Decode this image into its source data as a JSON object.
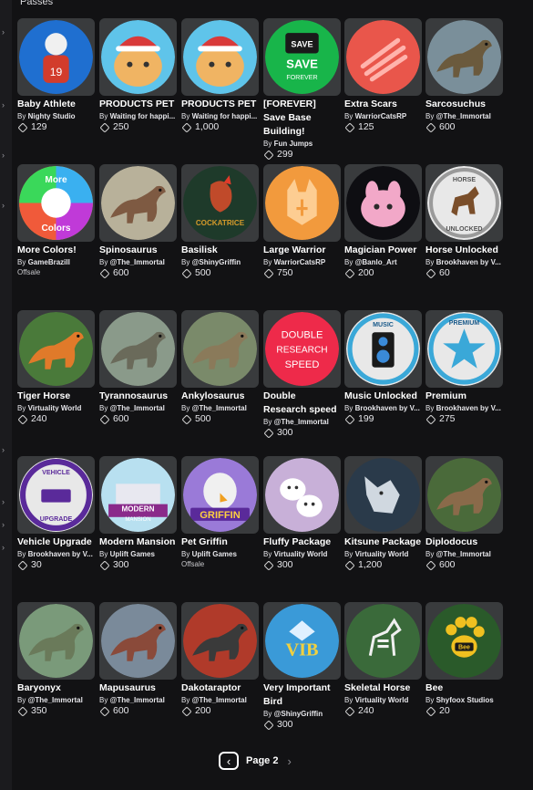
{
  "section_title": "Passes",
  "colors": {
    "background": "#121214",
    "card": "#393b3d",
    "text": "#ffffff"
  },
  "passes": [
    {
      "name": "Baby Athlete",
      "by": "By",
      "creator": "Nighty Studio",
      "price": "129",
      "icon": "football-player-icon",
      "bg": "#1f6fd0",
      "fg": "#d23c2c"
    },
    {
      "name": "PRODUCTS PET",
      "by": "By",
      "creator": "Waiting for happi...",
      "price": "250",
      "icon": "santa-cat-icon",
      "bg": "#5fc4ea",
      "fg": "#f0b463"
    },
    {
      "name": "PRODUCTS PET",
      "by": "By",
      "creator": "Waiting for happi...",
      "price": "1,000",
      "icon": "santa-cat-icon",
      "bg": "#5fc4ea",
      "fg": "#f0b463"
    },
    {
      "name": "[FOREVER] Save Base Building!",
      "by": "By",
      "creator": "Fun Jumps",
      "price": "299",
      "icon": "save-forever-icon",
      "bg": "#18b54a",
      "fg": "#ffffff"
    },
    {
      "name": "Extra Scars",
      "by": "By",
      "creator": "WarriorCatsRP",
      "price": "125",
      "icon": "claw-scars-icon",
      "bg": "#e9564b",
      "fg": "#ffb3ac"
    },
    {
      "name": "Sarcosuchus",
      "by": "By",
      "creator": "@The_Immortal",
      "price": "600",
      "icon": "crocodile-icon",
      "bg": "#7a8f9a",
      "fg": "#6b5a3d"
    },
    {
      "name": "More Colors!",
      "by": "By",
      "creator": "GameBrazill",
      "offsale": "Offsale",
      "icon": "color-wheel-icon",
      "bg": "#f1c232",
      "fg": "#ffffff"
    },
    {
      "name": "Spinosaurus",
      "by": "By",
      "creator": "@The_Immortal",
      "price": "600",
      "icon": "spinosaurus-icon",
      "bg": "#b8b19a",
      "fg": "#7e5a42"
    },
    {
      "name": "Basilisk",
      "by": "By",
      "creator": "@ShinyGriffin",
      "price": "500",
      "icon": "cockatrice-icon",
      "bg": "#1e3a2a",
      "fg": "#d49a2a"
    },
    {
      "name": "Large Warrior",
      "by": "By",
      "creator": "WarriorCatsRP",
      "price": "750",
      "icon": "warrior-cat-icon",
      "bg": "#f29a3d",
      "fg": "#ffd9a8"
    },
    {
      "name": "Magician Power",
      "by": "By",
      "creator": "@Banlo_Art",
      "price": "200",
      "icon": "pink-creature-icon",
      "bg": "#0e0e12",
      "fg": "#f2a8c8"
    },
    {
      "name": "Horse Unlocked",
      "by": "By",
      "creator": "Brookhaven by V...",
      "price": "60",
      "icon": "horse-badge-icon",
      "bg": "#e8e8e8",
      "fg": "#7a4e2a"
    },
    {
      "name": "Tiger Horse",
      "by": "By",
      "creator": "Virtuality World",
      "price": "240",
      "icon": "tiger-horse-icon",
      "bg": "#4a7a3a",
      "fg": "#e07a2a"
    },
    {
      "name": "Tyrannosaurus",
      "by": "By",
      "creator": "@The_Immortal",
      "price": "600",
      "icon": "tyrannosaurus-icon",
      "bg": "#8a9a8a",
      "fg": "#6a6a5a"
    },
    {
      "name": "Ankylosaurus",
      "by": "By",
      "creator": "@The_Immortal",
      "price": "500",
      "icon": "ankylosaurus-icon",
      "bg": "#7a8a6a",
      "fg": "#8a7a5a"
    },
    {
      "name": "Double Research speed",
      "by": "By",
      "creator": "@The_Immortal",
      "price": "300",
      "icon": "double-research-icon",
      "bg": "#ee2a4a",
      "fg": "#ffffff",
      "label": "DOUBLE RESEARCH SPEED"
    },
    {
      "name": "Music Unlocked",
      "by": "By",
      "creator": "Brookhaven by V...",
      "price": "199",
      "icon": "music-speaker-icon",
      "bg": "#e8e8e8",
      "fg": "#1a1a1a"
    },
    {
      "name": "Premium",
      "by": "By",
      "creator": "Brookhaven by V...",
      "price": "275",
      "icon": "premium-star-icon",
      "bg": "#e8e8e8",
      "fg": "#3aa8d8"
    },
    {
      "name": "Vehicle Upgrade",
      "by": "By",
      "creator": "Brookhaven by V...",
      "price": "30",
      "icon": "vehicle-upgrade-icon",
      "bg": "#e8e8e8",
      "fg": "#5a2a9a"
    },
    {
      "name": "Modern Mansion",
      "by": "By",
      "creator": "Uplift Games",
      "price": "300",
      "icon": "mansion-icon",
      "bg": "#b8e0f0",
      "fg": "#8a2a8a"
    },
    {
      "name": "Pet Griffin",
      "by": "By",
      "creator": "Uplift Games",
      "offsale": "Offsale",
      "icon": "griffin-icon",
      "bg": "#9a7ad8",
      "fg": "#f0f0f0"
    },
    {
      "name": "Fluffy Package",
      "by": "By",
      "creator": "Virtuality World",
      "price": "300",
      "icon": "fluffy-cats-icon",
      "bg": "#c8b0d8",
      "fg": "#ffffff"
    },
    {
      "name": "Kitsune Package",
      "by": "By",
      "creator": "Virtuality World",
      "price": "1,200",
      "icon": "kitsune-icon",
      "bg": "#2a3a4a",
      "fg": "#d0d8e0"
    },
    {
      "name": "Diplodocus",
      "by": "By",
      "creator": "@The_Immortal",
      "price": "600",
      "icon": "diplodocus-icon",
      "bg": "#4a6a3a",
      "fg": "#8a6a4a"
    },
    {
      "name": "Baryonyx",
      "by": "By",
      "creator": "@The_Immortal",
      "price": "350",
      "icon": "baryonyx-icon",
      "bg": "#7a9a7a",
      "fg": "#6a7a5a"
    },
    {
      "name": "Mapusaurus",
      "by": "By",
      "creator": "@The_Immortal",
      "price": "600",
      "icon": "mapusaurus-icon",
      "bg": "#7a8a9a",
      "fg": "#8a4a3a"
    },
    {
      "name": "Dakotaraptor",
      "by": "By",
      "creator": "@The_Immortal",
      "price": "200",
      "icon": "dakotaraptor-icon",
      "bg": "#b03a2a",
      "fg": "#3a3a3a"
    },
    {
      "name": "Very Important Bird",
      "by": "By",
      "creator": "@ShinyGriffin",
      "price": "300",
      "icon": "vib-bird-icon",
      "bg": "#3a9ad8",
      "fg": "#f0d040",
      "label": "VIB"
    },
    {
      "name": "Skeletal Horse",
      "by": "By",
      "creator": "Virtuality World",
      "price": "240",
      "icon": "skeletal-horse-icon",
      "bg": "#3a6a3a",
      "fg": "#f0f0f0"
    },
    {
      "name": "Bee",
      "by": "By",
      "creator": "Shyfoox Studios",
      "price": "20",
      "icon": "bee-paw-icon",
      "bg": "#2a5a2a",
      "fg": "#f0c020"
    }
  ],
  "pagination": {
    "prev_icon": "chevron-left-icon",
    "label": "Page 2",
    "next_icon": "chevron-right-icon"
  }
}
